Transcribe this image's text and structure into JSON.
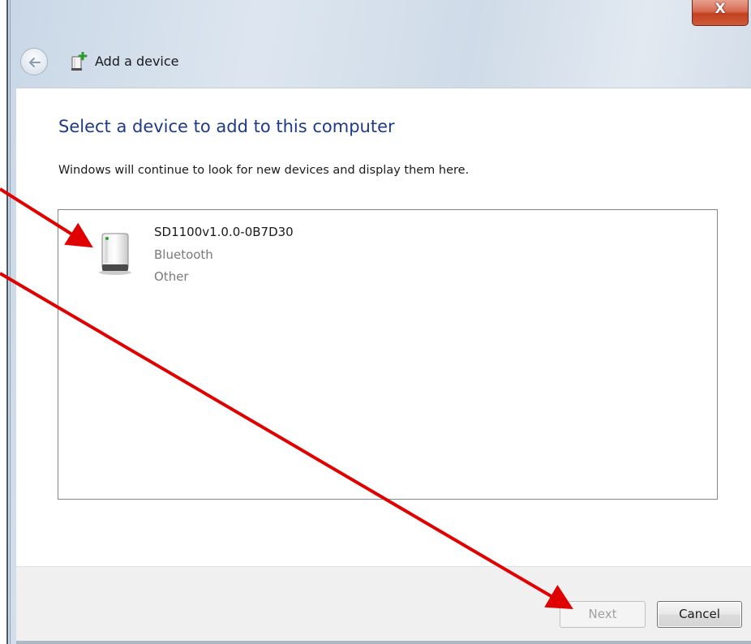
{
  "window": {
    "title": "Add a device",
    "close_glyph": "X"
  },
  "icons": {
    "back": "back-arrow-icon",
    "title": "add-device-icon",
    "device": "generic-device-icon",
    "close": "close-icon"
  },
  "main": {
    "heading": "Select a device to add to this computer",
    "description": "Windows will continue to look for new devices and display them here.",
    "devices": [
      {
        "name": "SD1100v1.0.0-0B7D30",
        "connection": "Bluetooth",
        "category": "Other"
      }
    ]
  },
  "footer": {
    "next_label": "Next",
    "next_enabled": false,
    "cancel_label": "Cancel"
  },
  "colors": {
    "heading": "#1e3a8a",
    "annotation_arrow": "#e00000",
    "close_button": "#c2411f"
  }
}
